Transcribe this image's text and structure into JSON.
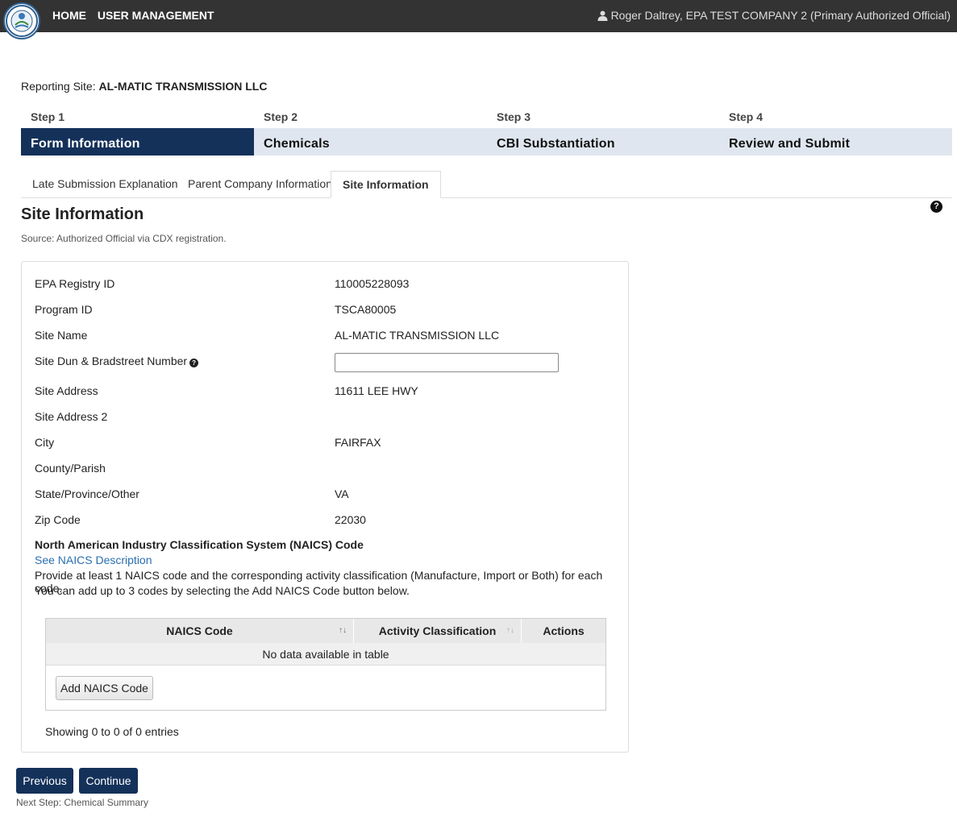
{
  "header": {
    "nav": [
      "HOME",
      "USER MANAGEMENT"
    ],
    "user": "Roger Daltrey, EPA TEST COMPANY 2 (Primary Authorized Official)"
  },
  "reporting_site": {
    "label": "Reporting Site:",
    "value": "AL-MATIC TRANSMISSION LLC"
  },
  "steps": [
    {
      "num": "Step 1",
      "label": "Form Information"
    },
    {
      "num": "Step 2",
      "label": "Chemicals"
    },
    {
      "num": "Step 3",
      "label": "CBI Substantiation"
    },
    {
      "num": "Step 4",
      "label": "Review and Submit"
    }
  ],
  "tabs": [
    "Late Submission Explanation",
    "Parent Company Information",
    "Site Information"
  ],
  "section": {
    "title": "Site Information",
    "source": "Source: Authorized Official via CDX registration."
  },
  "fields": [
    {
      "label": "EPA Registry ID",
      "value": "110005228093"
    },
    {
      "label": "Program ID",
      "value": "TSCA80005"
    },
    {
      "label": "Site Name",
      "value": "AL-MATIC TRANSMISSION LLC"
    },
    {
      "label": "Site Dun & Bradstreet Number",
      "value": ""
    },
    {
      "label": "Site Address",
      "value": "11611 LEE HWY"
    },
    {
      "label": "Site Address 2",
      "value": ""
    },
    {
      "label": "City",
      "value": "FAIRFAX"
    },
    {
      "label": "County/Parish",
      "value": ""
    },
    {
      "label": "State/Province/Other",
      "value": "VA"
    },
    {
      "label": "Zip Code",
      "value": "22030"
    }
  ],
  "naics": {
    "title": "North American Industry Classification System (NAICS) Code",
    "link": "See NAICS Description",
    "p1": "Provide at least 1 NAICS code and the corresponding activity classification (Manufacture, Import or Both) for each code.",
    "p2": "You can add up to 3 codes by selecting the Add NAICS Code button below.",
    "columns": [
      "NAICS Code",
      "Activity Classification",
      "Actions"
    ],
    "empty": "No data available in table",
    "add_button": "Add NAICS Code",
    "showing": "Showing 0 to 0 of 0 entries"
  },
  "footer": {
    "previous": "Previous",
    "continue": "Continue",
    "next_step": "Next Step: Chemical Summary"
  }
}
